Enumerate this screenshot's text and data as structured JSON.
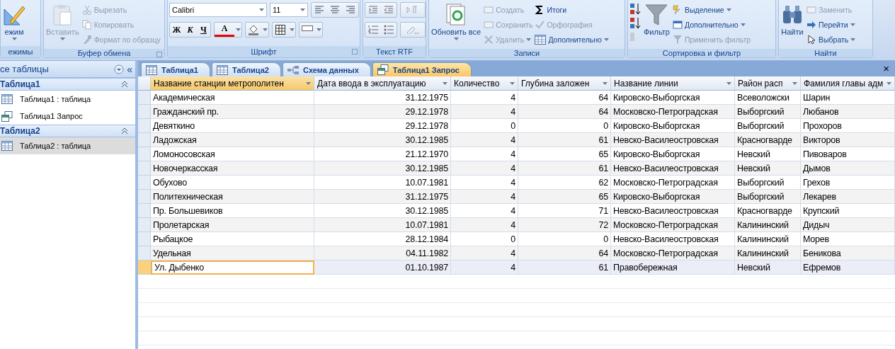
{
  "ribbon": {
    "groups": [
      {
        "label": "ежимы",
        "kind": "views",
        "buttons": [
          {
            "label": "ежим",
            "kind": "large",
            "disabled": false,
            "dropdown": true
          }
        ]
      },
      {
        "label": "Буфер обмена",
        "kind": "clipboard",
        "launcher": true,
        "buttons": [
          {
            "label": "Вставить",
            "kind": "large",
            "disabled": true,
            "dropdown": true
          },
          {
            "label": "Вырезать",
            "kind": "small",
            "disabled": true,
            "dropdown": false
          },
          {
            "label": "Копировать",
            "kind": "small",
            "disabled": true,
            "dropdown": false
          },
          {
            "label": "Формат по образцу",
            "kind": "small",
            "disabled": true,
            "dropdown": false
          }
        ]
      },
      {
        "label": "Шрифт",
        "kind": "font",
        "launcher": true,
        "font": "Calibri",
        "size": "11",
        "styles": [
          "Ж",
          "К",
          "Ч"
        ],
        "color_letter": "А"
      },
      {
        "label": "Текст RTF",
        "kind": "rtf"
      },
      {
        "label": "Записи",
        "kind": "records",
        "buttons": [
          {
            "label": "Обновить все",
            "kind": "large",
            "disabled": false,
            "dropdown": true
          },
          {
            "label": "Создать",
            "kind": "small",
            "disabled": true,
            "dropdown": false
          },
          {
            "label": "Сохранить",
            "kind": "small",
            "disabled": true,
            "dropdown": false
          },
          {
            "label": "Удалить",
            "kind": "small",
            "disabled": true,
            "dropdown": true
          },
          {
            "label": "Итоги",
            "kind": "small",
            "disabled": false,
            "dropdown": false
          },
          {
            "label": "Орфография",
            "kind": "small",
            "disabled": true,
            "dropdown": false
          },
          {
            "label": "Дополнительно",
            "kind": "small",
            "disabled": false,
            "dropdown": true
          }
        ]
      },
      {
        "label": "Сортировка и фильтр",
        "kind": "sort",
        "buttons": [
          {
            "label": "Фильтр",
            "kind": "large",
            "disabled": false,
            "dropdown": false
          },
          {
            "label": "Выделение",
            "kind": "small",
            "disabled": false,
            "dropdown": true
          },
          {
            "label": "Дополнительно",
            "kind": "small",
            "disabled": false,
            "dropdown": true
          },
          {
            "label": "Применить фильтр",
            "kind": "small",
            "disabled": true,
            "dropdown": false
          }
        ]
      },
      {
        "label": "Найти",
        "kind": "find",
        "buttons": [
          {
            "label": "Найти",
            "kind": "large",
            "disabled": false,
            "dropdown": false
          },
          {
            "label": "Заменить",
            "kind": "small",
            "disabled": true,
            "dropdown": false
          },
          {
            "label": "Перейти",
            "kind": "small",
            "disabled": false,
            "dropdown": true
          },
          {
            "label": "Выбрать",
            "kind": "small",
            "disabled": false,
            "dropdown": true
          }
        ]
      }
    ]
  },
  "nav": {
    "title": "се таблицы",
    "collapse": "«",
    "sections": [
      {
        "label": "Таблица1",
        "expanded": true,
        "items": [
          {
            "label": "Таблица1 : таблица",
            "kind": "table",
            "selected": false
          },
          {
            "label": "Таблица1 Запрос",
            "kind": "query",
            "selected": false
          }
        ]
      },
      {
        "label": "Таблица2",
        "expanded": true,
        "items": [
          {
            "label": "Таблица2 : таблица",
            "kind": "table",
            "selected": true
          }
        ]
      }
    ]
  },
  "tabs": [
    {
      "label": "Таблица1",
      "kind": "table",
      "selected": false
    },
    {
      "label": "Таблица2",
      "kind": "table",
      "selected": false
    },
    {
      "label": "Схема данных",
      "kind": "schema",
      "selected": false
    },
    {
      "label": "Таблица1 Запрос",
      "kind": "query",
      "selected": true
    }
  ],
  "close": "×",
  "table": {
    "columns": [
      {
        "label": "Название станции метрополитен",
        "selected": true
      },
      {
        "label": "Дата ввода в эксплуатацию",
        "selected": false
      },
      {
        "label": "Количество",
        "selected": false
      },
      {
        "label": "Глубина заложен",
        "selected": false
      },
      {
        "label": "Название линии",
        "selected": false
      },
      {
        "label": "Район расп",
        "selected": false
      },
      {
        "label": "Фамилия главы адм",
        "selected": false
      }
    ],
    "rows": [
      {
        "selected": false,
        "cells": [
          "Академическая",
          "31.12.1975",
          "4",
          "64",
          "Кировско-Выборгская",
          "Всеволожски",
          "Шарин"
        ]
      },
      {
        "selected": false,
        "cells": [
          "Гражданский пр.",
          "29.12.1978",
          "4",
          "64",
          "Московско-Петроградская",
          "Выборгский",
          "Любанов"
        ]
      },
      {
        "selected": false,
        "cells": [
          "Девяткино",
          "29.12.1978",
          "0",
          "0",
          "Кировско-Выборгская",
          "Выборгский",
          "Прохоров"
        ]
      },
      {
        "selected": false,
        "cells": [
          "Ладожская",
          "30.12.1985",
          "4",
          "61",
          "Невско-Василеостровская",
          "Красногварде",
          "Викторов"
        ]
      },
      {
        "selected": false,
        "cells": [
          "Ломоносовская",
          "21.12.1970",
          "4",
          "65",
          "Кировско-Выборгская",
          "Невский",
          "Пивоваров"
        ]
      },
      {
        "selected": false,
        "cells": [
          "Новочеркасская",
          "30.12.1985",
          "4",
          "61",
          "Невско-Василеостровская",
          "Невский",
          "Дымов"
        ]
      },
      {
        "selected": false,
        "cells": [
          "Обухово",
          "10.07.1981",
          "4",
          "62",
          "Московско-Петроградская",
          "Выборгский",
          "Грехов"
        ]
      },
      {
        "selected": false,
        "cells": [
          "Политехническая",
          "31.12.1975",
          "4",
          "65",
          "Кировско-Выборгская",
          "Выборгский",
          "Лекарев"
        ]
      },
      {
        "selected": false,
        "cells": [
          "Пр. Большевиков",
          "30.12.1985",
          "4",
          "71",
          "Невско-Василеостровская",
          "Красногварде",
          "Крупский"
        ]
      },
      {
        "selected": false,
        "cells": [
          "Пролетарская",
          "10.07.1981",
          "4",
          "72",
          "Московско-Петроградская",
          "Калининский",
          "Дидыч"
        ]
      },
      {
        "selected": false,
        "cells": [
          "Рыбацкое",
          "28.12.1984",
          "0",
          "0",
          "Невско-Василеостровская",
          "Калининский",
          "Морев"
        ]
      },
      {
        "selected": false,
        "cells": [
          "Удельная",
          "04.11.1982",
          "4",
          "64",
          "Московско-Петроградская",
          "Калининский",
          "Беникова"
        ]
      },
      {
        "selected": true,
        "cells": [
          "Ул. Дыбенко",
          "01.10.1987",
          "4",
          "61",
          "Правобережная",
          "Невский",
          "Ефремов"
        ]
      }
    ]
  }
}
